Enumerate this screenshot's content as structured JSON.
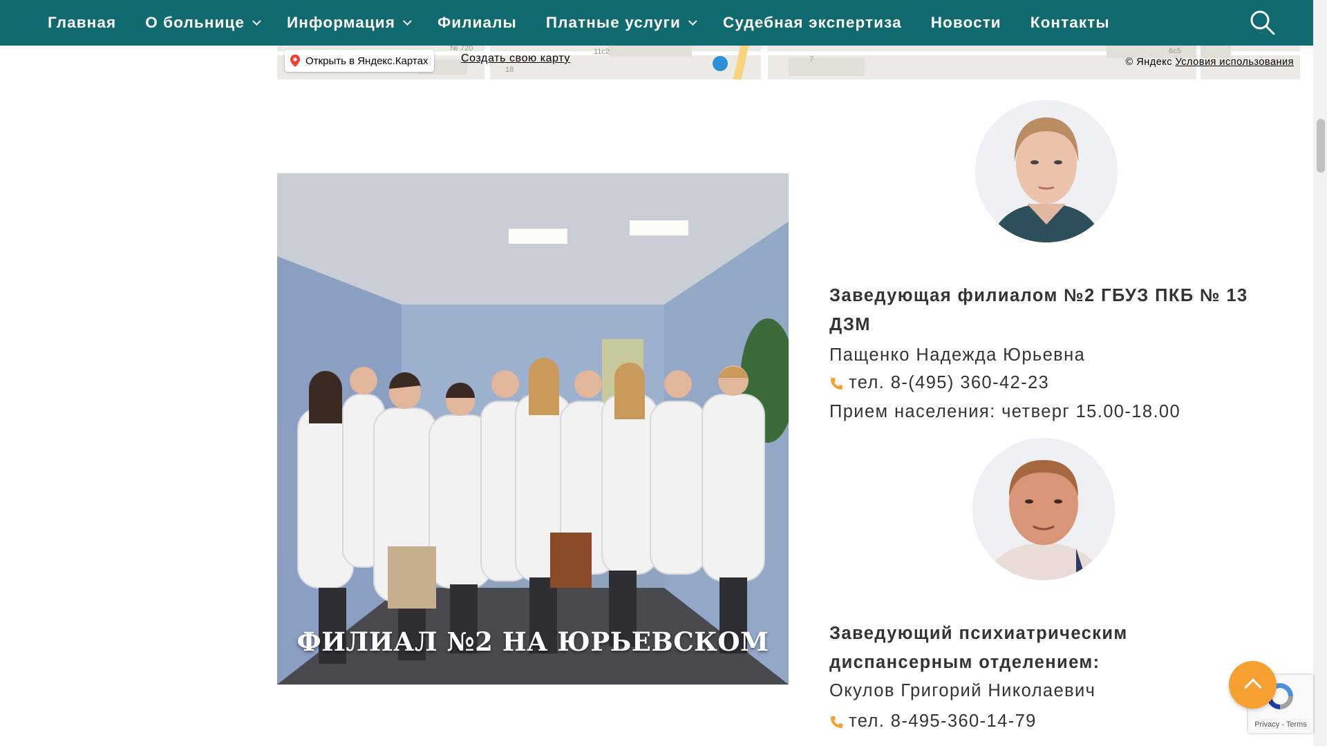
{
  "nav": {
    "items": [
      {
        "label": "Главная",
        "dropdown": false
      },
      {
        "label": "О больнице",
        "dropdown": true
      },
      {
        "label": "Информация",
        "dropdown": true
      },
      {
        "label": "Филиалы",
        "dropdown": false
      },
      {
        "label": "Платные услуги",
        "dropdown": true
      },
      {
        "label": "Судебная экспертиза",
        "dropdown": false
      },
      {
        "label": "Новости",
        "dropdown": false
      },
      {
        "label": "Контакты",
        "dropdown": false
      }
    ],
    "search_icon": "search-icon",
    "background": "#106a70"
  },
  "map": {
    "open_label": "Открыть в Яндекс.Картах",
    "create_label": "Создать свою карту",
    "copyright": "© Яндекс",
    "terms_label": "Условия использования",
    "labels": [
      "№ 720",
      "11с2",
      "18",
      "7",
      "6с5"
    ]
  },
  "photo": {
    "caption": "ФИЛИАЛ №2 НА ЮРЬЕВСКОМ"
  },
  "staff": [
    {
      "title": "Заведующая филиалом №2 ГБУЗ ПКБ № 13 ДЗМ",
      "name": "Пащенко Надежда Юрьевна",
      "phone": "тел. 8-(495) 360-42-23",
      "hours": "Прием населения: четверг 15.00-18.00"
    },
    {
      "title": "Заведующий психиатрическим диспансерным отделением:",
      "name": "Окулов Григорий Николаевич",
      "phone": "тел. 8-495-360-14-79"
    }
  ],
  "recaptcha": {
    "privacy": "Privacy",
    "separator": " - ",
    "terms": "Terms"
  },
  "colors": {
    "accent": "#106a70",
    "to_top": "#f5a031",
    "phone_icon": "#f5a031"
  }
}
